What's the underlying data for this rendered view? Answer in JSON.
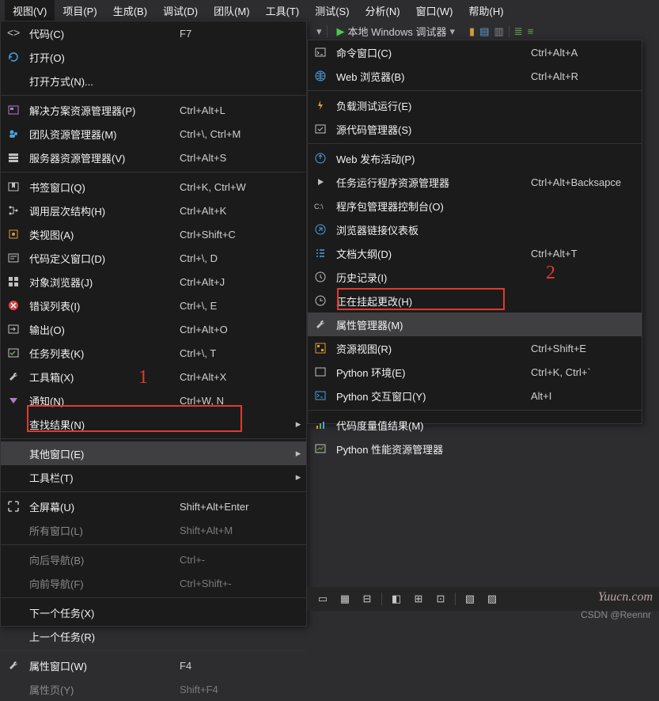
{
  "menubar": [
    "视图(V)",
    "项目(P)",
    "生成(B)",
    "调试(D)",
    "团队(M)",
    "工具(T)",
    "测试(S)",
    "分析(N)",
    "窗口(W)",
    "帮助(H)"
  ],
  "debugger_label": "本地 Windows 调试器",
  "annotations": {
    "one": "1",
    "two": "2"
  },
  "watermark": "Yuucn.com",
  "credit": "CSDN @Reennr",
  "main_menu": [
    {
      "icon": "code",
      "label": "代码(C)",
      "short": "F7",
      "arrow": false
    },
    {
      "icon": "open",
      "label": "打开(O)",
      "short": "",
      "arrow": false
    },
    {
      "icon": "",
      "label": "打开方式(N)...",
      "short": "",
      "arrow": false,
      "sep": true
    },
    {
      "icon": "solution",
      "label": "解决方案资源管理器(P)",
      "short": "Ctrl+Alt+L",
      "arrow": false
    },
    {
      "icon": "team",
      "label": "团队资源管理器(M)",
      "short": "Ctrl+\\, Ctrl+M",
      "arrow": false
    },
    {
      "icon": "server",
      "label": "服务器资源管理器(V)",
      "short": "Ctrl+Alt+S",
      "arrow": false,
      "sep": true
    },
    {
      "icon": "bookmark",
      "label": "书签窗口(Q)",
      "short": "Ctrl+K, Ctrl+W",
      "arrow": false
    },
    {
      "icon": "hierarchy",
      "label": "调用层次结构(H)",
      "short": "Ctrl+Alt+K",
      "arrow": false
    },
    {
      "icon": "class",
      "label": "类视图(A)",
      "short": "Ctrl+Shift+C",
      "arrow": false
    },
    {
      "icon": "codedef",
      "label": "代码定义窗口(D)",
      "short": "Ctrl+\\, D",
      "arrow": false
    },
    {
      "icon": "object",
      "label": "对象浏览器(J)",
      "short": "Ctrl+Alt+J",
      "arrow": false
    },
    {
      "icon": "error",
      "label": "错误列表(I)",
      "short": "Ctrl+\\, E",
      "arrow": false
    },
    {
      "icon": "output",
      "label": "输出(O)",
      "short": "Ctrl+Alt+O",
      "arrow": false
    },
    {
      "icon": "task",
      "label": "任务列表(K)",
      "short": "Ctrl+\\, T",
      "arrow": false
    },
    {
      "icon": "toolbox",
      "label": "工具箱(X)",
      "short": "Ctrl+Alt+X",
      "arrow": false
    },
    {
      "icon": "notify",
      "label": "通知(N)",
      "short": "Ctrl+W, N",
      "arrow": false
    },
    {
      "icon": "",
      "label": "查找结果(N)",
      "short": "",
      "arrow": true,
      "sep": true
    },
    {
      "icon": "",
      "label": "其他窗口(E)",
      "short": "",
      "arrow": true,
      "hov": true
    },
    {
      "icon": "",
      "label": "工具栏(T)",
      "short": "",
      "arrow": true,
      "sep": true
    },
    {
      "icon": "fullscreen",
      "label": "全屏幕(U)",
      "short": "Shift+Alt+Enter",
      "arrow": false
    },
    {
      "icon": "",
      "label": "所有窗口(L)",
      "short": "Shift+Alt+M",
      "arrow": false,
      "dim": true,
      "sep": true
    },
    {
      "icon": "",
      "label": "向后导航(B)",
      "short": "Ctrl+-",
      "arrow": false,
      "dim": true
    },
    {
      "icon": "",
      "label": "向前导航(F)",
      "short": "Ctrl+Shift+-",
      "arrow": false,
      "dim": true,
      "sep": true
    },
    {
      "icon": "",
      "label": "下一个任务(X)",
      "short": "",
      "arrow": false
    },
    {
      "icon": "",
      "label": "上一个任务(R)",
      "short": "",
      "arrow": false,
      "sep": true
    },
    {
      "icon": "wrench",
      "label": "属性窗口(W)",
      "short": "F4",
      "arrow": false
    },
    {
      "icon": "",
      "label": "属性页(Y)",
      "short": "Shift+F4",
      "arrow": false,
      "dim": true
    }
  ],
  "sub_menu": [
    {
      "icon": "cmd",
      "label": "命令窗口(C)",
      "short": "Ctrl+Alt+A"
    },
    {
      "icon": "web",
      "label": "Web 浏览器(B)",
      "short": "Ctrl+Alt+R",
      "sep": true
    },
    {
      "icon": "load",
      "label": "负载测试运行(E)",
      "short": ""
    },
    {
      "icon": "source",
      "label": "源代码管理器(S)",
      "short": "",
      "sep": true
    },
    {
      "icon": "publish",
      "label": "Web 发布活动(P)",
      "short": ""
    },
    {
      "icon": "taskrun",
      "label": "任务运行程序资源管理器",
      "short": "Ctrl+Alt+Backsapce"
    },
    {
      "icon": "pkg",
      "label": "程序包管理器控制台(O)",
      "short": ""
    },
    {
      "icon": "browser",
      "label": "浏览器链接仪表板",
      "short": ""
    },
    {
      "icon": "outline",
      "label": "文档大纲(D)",
      "short": "Ctrl+Alt+T"
    },
    {
      "icon": "history",
      "label": "历史记录(I)",
      "short": ""
    },
    {
      "icon": "pending",
      "label": "正在挂起更改(H)",
      "short": ""
    },
    {
      "icon": "wrench",
      "label": "属性管理器(M)",
      "short": "",
      "hov": true
    },
    {
      "icon": "resource",
      "label": "资源视图(R)",
      "short": "Ctrl+Shift+E"
    },
    {
      "icon": "python",
      "label": "Python 环境(E)",
      "short": "Ctrl+K, Ctrl+`"
    },
    {
      "icon": "pyint",
      "label": "Python 交互窗口(Y)",
      "short": "Alt+I",
      "sep": true
    },
    {
      "icon": "metrics",
      "label": "代码度量值结果(M)",
      "short": ""
    },
    {
      "icon": "pyperf",
      "label": "Python 性能资源管理器",
      "short": ""
    }
  ]
}
